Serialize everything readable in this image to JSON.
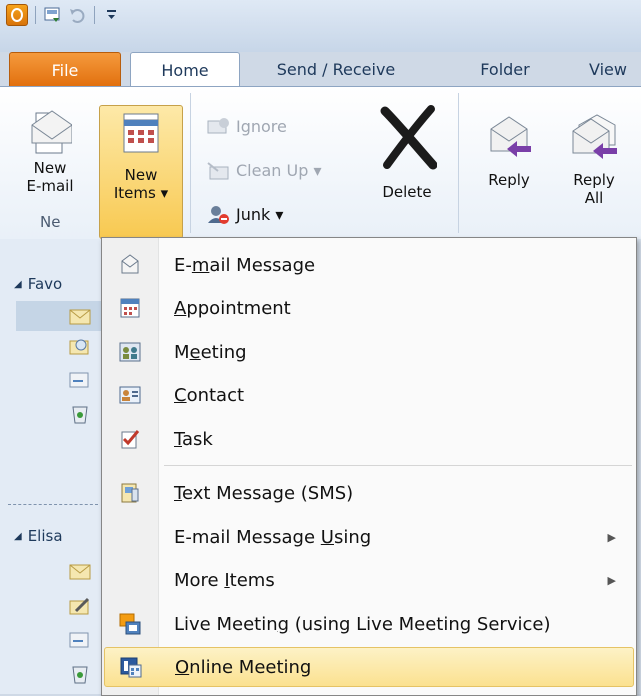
{
  "qat": {
    "app_icon": "outlook-app-icon",
    "icons": [
      "send-receive-all-icon",
      "undo-icon",
      "customize-qat-icon"
    ]
  },
  "tabs": [
    {
      "id": "file",
      "label": "File"
    },
    {
      "id": "home",
      "label": "Home"
    },
    {
      "id": "send",
      "label": "Send / Receive"
    },
    {
      "id": "folder",
      "label": "Folder"
    },
    {
      "id": "view",
      "label": "View"
    }
  ],
  "ribbon": {
    "new_email": {
      "line1": "New",
      "line2": "E-mail"
    },
    "new_items": {
      "line1": "New",
      "line2": "Items ▾"
    },
    "ignore": "Ignore",
    "cleanup": "Clean Up ▾",
    "junk": "Junk ▾",
    "delete": "Delete",
    "reply": "Reply",
    "reply_all": {
      "line1": "Reply",
      "line2": "All"
    },
    "new_group_label": "Ne"
  },
  "nav": {
    "favorites": "Favo",
    "account": "Elisa"
  },
  "menu": {
    "items": [
      {
        "pre": "E-",
        "u": "m",
        "post": "ail Message",
        "icon": "email-message-icon"
      },
      {
        "pre": "",
        "u": "A",
        "post": "ppointment",
        "icon": "calendar-icon"
      },
      {
        "pre": "M",
        "u": "e",
        "post": "eting",
        "icon": "meeting-icon"
      },
      {
        "pre": "",
        "u": "C",
        "post": "ontact",
        "icon": "contact-card-icon"
      },
      {
        "pre": "",
        "u": "T",
        "post": "ask",
        "icon": "task-icon"
      },
      {
        "pre": "",
        "u": "T",
        "post": "ext Message (SMS)",
        "icon": "text-message-icon"
      },
      {
        "pre": "E-mail Message ",
        "u": "U",
        "post": "sing",
        "icon": ""
      },
      {
        "pre": "More ",
        "u": "I",
        "post": "tems",
        "icon": ""
      },
      {
        "pre": "Live Meetin",
        "u": "g",
        "post": " (using Live Meeting Service)",
        "icon": "live-meeting-icon"
      },
      {
        "pre": "",
        "u": "O",
        "post": "nline Meeting",
        "icon": "online-meeting-icon"
      }
    ]
  }
}
